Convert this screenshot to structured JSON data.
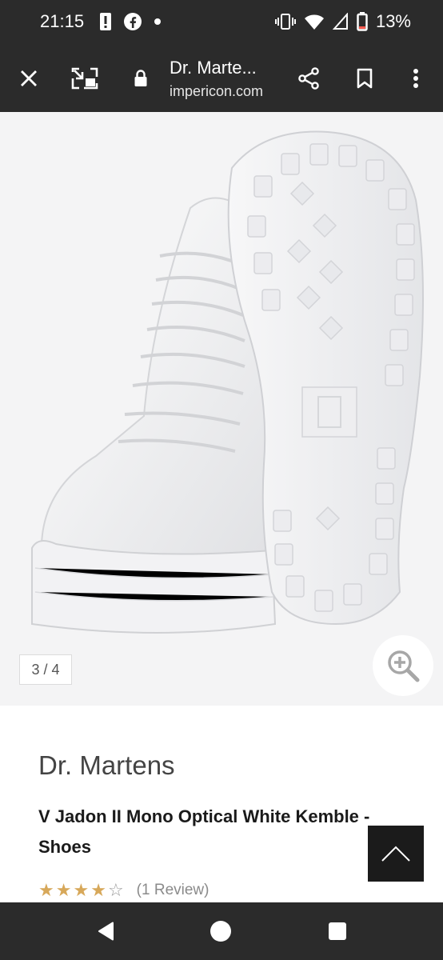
{
  "status_bar": {
    "time": "21:15",
    "battery": "13%",
    "icons": [
      "alert-icon",
      "facebook-icon",
      "dot-icon",
      "vibrate-icon",
      "wifi-icon",
      "signal-icon",
      "battery-icon"
    ]
  },
  "browser": {
    "title": "Dr. Marte...",
    "url": "impericon.com",
    "icons": [
      "close-icon",
      "open-in-app-icon",
      "lock-icon",
      "share-icon",
      "bookmark-icon",
      "more-vert-icon"
    ]
  },
  "gallery": {
    "counter": "3 / 4",
    "icons": [
      "zoom-in-icon"
    ]
  },
  "product": {
    "brand": "Dr. Martens",
    "name": "V Jadon II Mono Optical White Kemble - Shoes",
    "rating": 4,
    "rating_max": 5,
    "review_text": "(1 Review)"
  },
  "colors": {
    "chrome": "#2b2b2b",
    "star_filled": "#d7a85a",
    "back_to_top": "#1b1b1b"
  },
  "nav_bar": {
    "icons": [
      "back-triangle-icon",
      "home-circle-icon",
      "recents-square-icon"
    ]
  }
}
